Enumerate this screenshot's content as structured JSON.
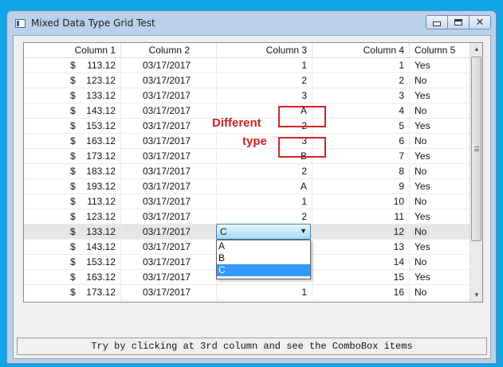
{
  "window": {
    "title": "Mixed Data Type Grid Test"
  },
  "grid": {
    "columns": [
      "Column 1",
      "Column 2",
      "Column 3",
      "Column 4",
      "Column 5"
    ],
    "rows": [
      {
        "currency": "$",
        "amount": "113.12",
        "date": "03/17/2017",
        "mixed": "1",
        "num": "1",
        "flag": "Yes"
      },
      {
        "currency": "$",
        "amount": "123.12",
        "date": "03/17/2017",
        "mixed": "2",
        "num": "2",
        "flag": "No"
      },
      {
        "currency": "$",
        "amount": "133.12",
        "date": "03/17/2017",
        "mixed": "3",
        "num": "3",
        "flag": "Yes"
      },
      {
        "currency": "$",
        "amount": "143.12",
        "date": "03/17/2017",
        "mixed": "A",
        "num": "4",
        "flag": "No"
      },
      {
        "currency": "$",
        "amount": "153.12",
        "date": "03/17/2017",
        "mixed": "2",
        "num": "5",
        "flag": "Yes"
      },
      {
        "currency": "$",
        "amount": "163.12",
        "date": "03/17/2017",
        "mixed": "3",
        "num": "6",
        "flag": "No"
      },
      {
        "currency": "$",
        "amount": "173.12",
        "date": "03/17/2017",
        "mixed": "B",
        "num": "7",
        "flag": "Yes"
      },
      {
        "currency": "$",
        "amount": "183.12",
        "date": "03/17/2017",
        "mixed": "2",
        "num": "8",
        "flag": "No"
      },
      {
        "currency": "$",
        "amount": "193.12",
        "date": "03/17/2017",
        "mixed": "A",
        "num": "9",
        "flag": "Yes"
      },
      {
        "currency": "$",
        "amount": "113.12",
        "date": "03/17/2017",
        "mixed": "1",
        "num": "10",
        "flag": "No"
      },
      {
        "currency": "$",
        "amount": "123.12",
        "date": "03/17/2017",
        "mixed": "2",
        "num": "11",
        "flag": "Yes"
      },
      {
        "currency": "$",
        "amount": "133.12",
        "date": "03/17/2017",
        "mixed": "",
        "num": "12",
        "flag": "No"
      },
      {
        "currency": "$",
        "amount": "143.12",
        "date": "03/17/2017",
        "mixed": "",
        "num": "13",
        "flag": "Yes"
      },
      {
        "currency": "$",
        "amount": "153.12",
        "date": "03/17/2017",
        "mixed": "",
        "num": "14",
        "flag": "No"
      },
      {
        "currency": "$",
        "amount": "163.12",
        "date": "03/17/2017",
        "mixed": "",
        "num": "15",
        "flag": "Yes"
      },
      {
        "currency": "$",
        "amount": "173.12",
        "date": "03/17/2017",
        "mixed": "1",
        "num": "16",
        "flag": "No"
      }
    ],
    "selected_row": 11
  },
  "combobox": {
    "value": "C",
    "options": [
      "A",
      "B",
      "C"
    ],
    "highlighted": "C"
  },
  "annotation": {
    "line1": "Different",
    "line2": "type",
    "color": "#d32222"
  },
  "status": {
    "text": "Try by clicking at 3rd column and see the ComboBox items"
  }
}
